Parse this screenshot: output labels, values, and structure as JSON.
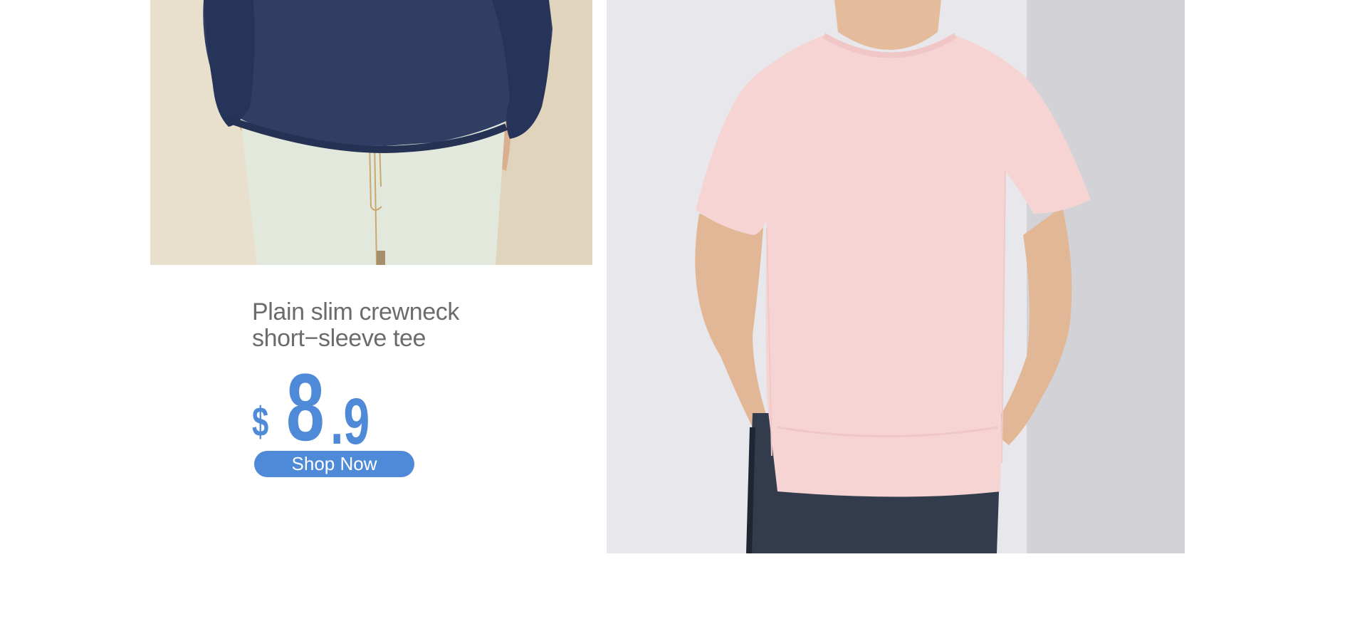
{
  "product": {
    "title_line1": "Plain slim crewneck",
    "title_line2": "short−sleeve tee",
    "price": {
      "currency": "$",
      "integer": "8",
      "decimal": ".9"
    },
    "cta_label": "Shop Now"
  },
  "colors": {
    "accent": "#4f8ad8",
    "title_text": "#6b6b6b",
    "background": "#ffffff"
  }
}
